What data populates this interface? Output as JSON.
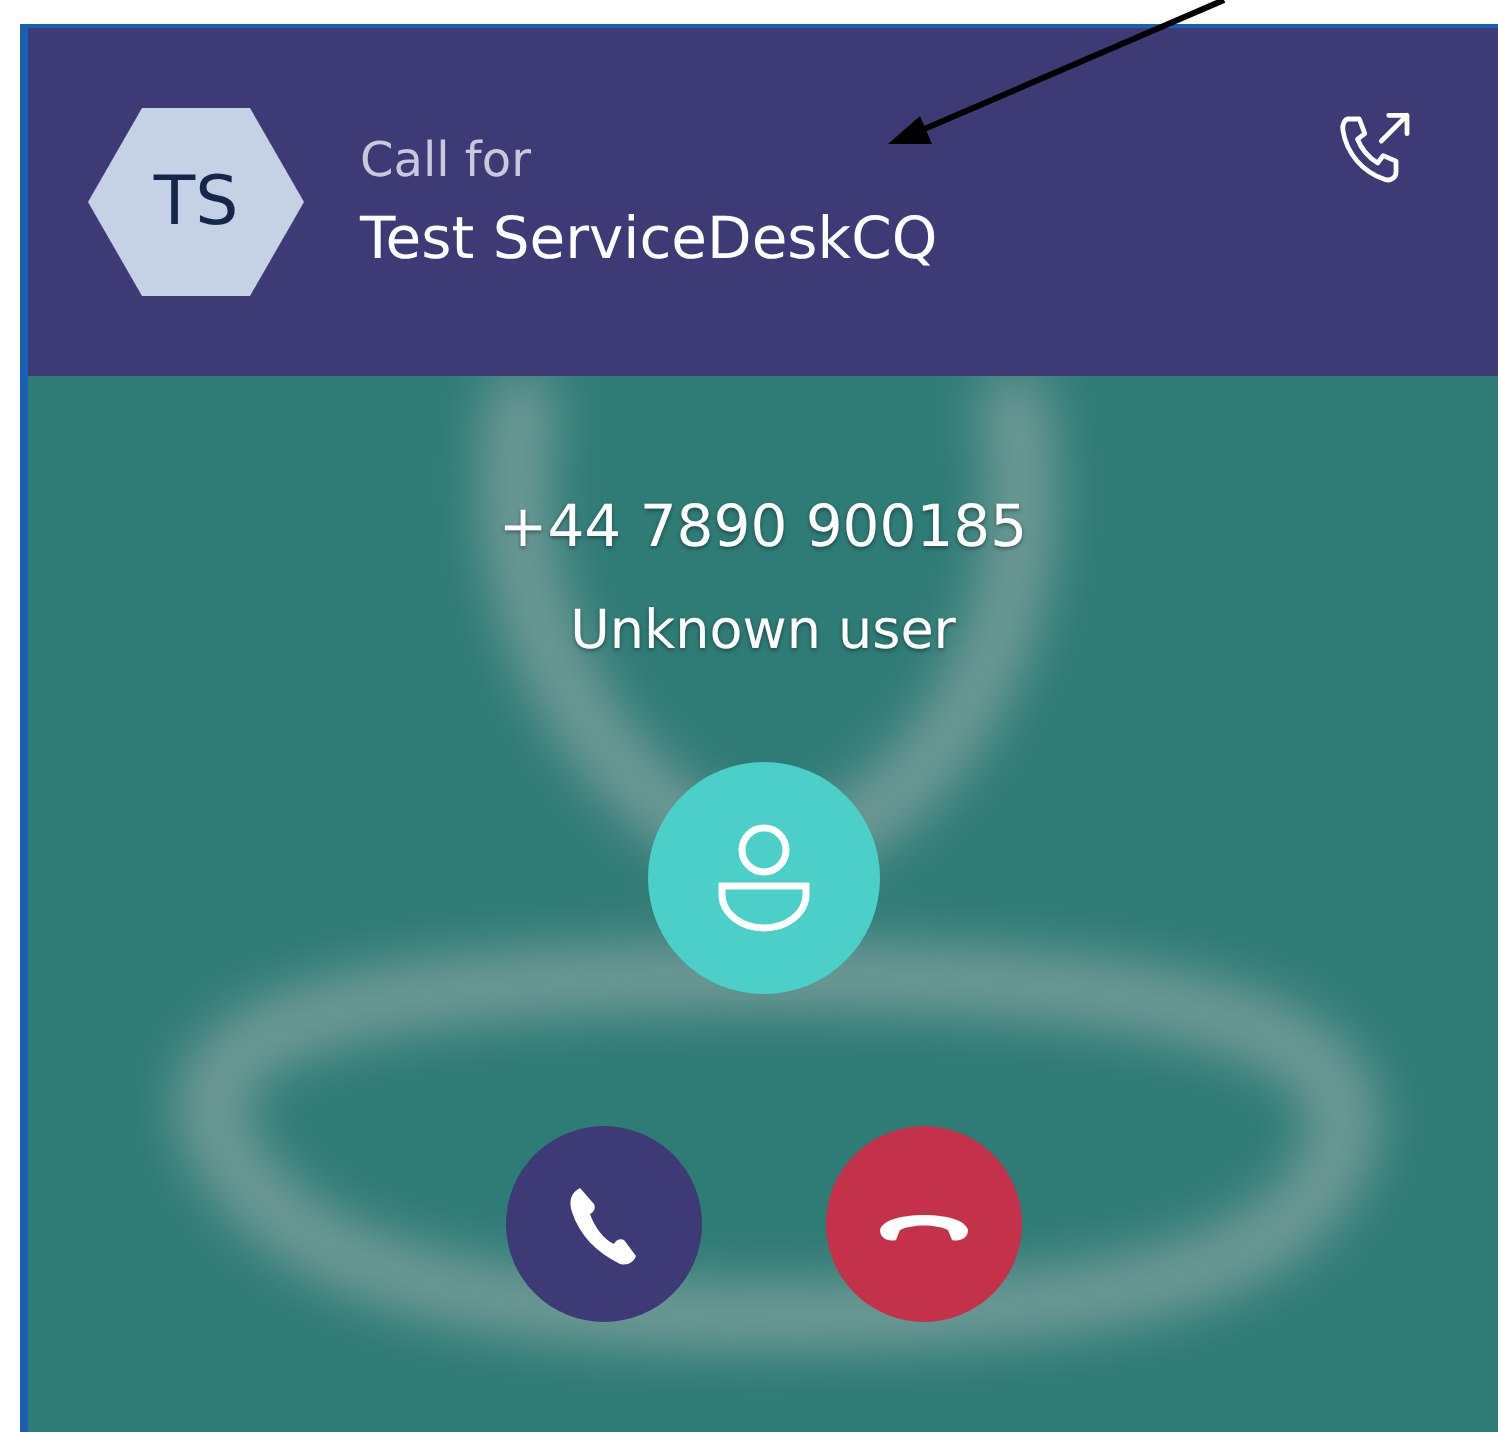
{
  "header": {
    "avatar_initials": "TS",
    "label": "Call for",
    "name": "Test ServiceDeskCQ"
  },
  "caller": {
    "number": "+44 7890 900185",
    "status": "Unknown user"
  },
  "actions": [
    {
      "kind": "accept"
    },
    {
      "kind": "decline"
    }
  ]
}
